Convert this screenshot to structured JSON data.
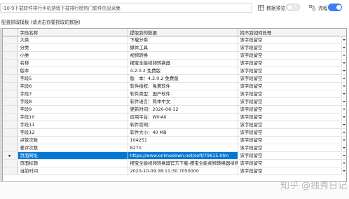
{
  "toolbar": {
    "title_input_value": "-10-9下载软件排行手机游戏下载排行榜热门软件信息采集",
    "preview_label": "数据预览",
    "flow_label": "流程",
    "preview_icon": "grid-icon",
    "flow_icon": "flow-icon",
    "preview_toggle_on": false,
    "flow_toggle_on": true
  },
  "subheading": "配置抓取模板 (请点击你要抓取的数据)",
  "grid": {
    "headers": [
      "字段名称",
      "提取到的数据",
      "找不到如何处理"
    ],
    "rows": [
      {
        "name": "大类",
        "data": "下载分类",
        "action": "该字段留空"
      },
      {
        "name": "分类",
        "data": "媒体工具",
        "action": "该字段留空"
      },
      {
        "name": "小类",
        "data": "视频转换",
        "action": "该字段留空"
      },
      {
        "name": "名称",
        "data": "摆宝全能视频转换器",
        "action": "该字段留空"
      },
      {
        "name": "版本",
        "data": "4.2.0.2 免费版",
        "action": "该字段留空"
      },
      {
        "name": "字段5",
        "data": "版　本：4.2.0.2 免费版",
        "action": "该字段留空"
      },
      {
        "name": "字段6",
        "data": "软件授权：免费软件",
        "action": "该字段留空"
      },
      {
        "name": "字段7",
        "data": "软件类型：国产软件",
        "action": "该字段留空"
      },
      {
        "name": "字段8",
        "data": "软件语言：简体中文",
        "action": "该字段留空"
      },
      {
        "name": "字段9",
        "data": "更新时间：2020-06-12",
        "action": "该字段留空"
      },
      {
        "name": "字段10",
        "data": "应用平台：WinAll",
        "action": "该字段留空"
      },
      {
        "name": "字段11",
        "data": "软件官网：",
        "action": "该字段留空"
      },
      {
        "name": "字段12",
        "data": "软件大小：40 MB",
        "action": "该字段留空"
      },
      {
        "name": "点赞次数",
        "data": "104251",
        "action": "该字段留空"
      },
      {
        "name": "差评次数",
        "data": "8270",
        "action": "该字段留空"
      },
      {
        "name": "页面网址",
        "data": "https://www.onlinedown.net/soft/79615.htm",
        "action": "该字段留空",
        "selected": true
      },
      {
        "name": "页面标题",
        "data": "摆宝全能视频转换器官方下载-摆宝全能视频转换器绿色...",
        "action": "该字段留空"
      },
      {
        "name": "当前时间",
        "data": "2020-10-09 08:11:30.7050000",
        "action": "该字段留空"
      }
    ],
    "selected_row_marker": "▸"
  },
  "watermark": "知乎 @独秀日记",
  "colors": {
    "selection": "#0078d7",
    "toggle_on": "#3d7cf4"
  }
}
